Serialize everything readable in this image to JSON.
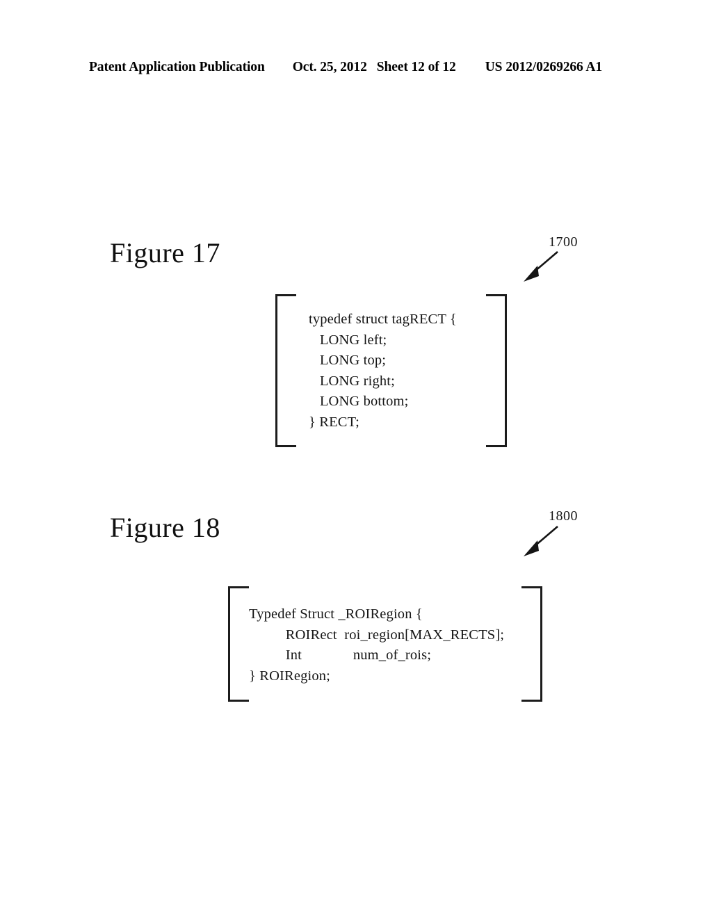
{
  "header": {
    "publication": "Patent Application Publication",
    "date": "Oct. 25, 2012",
    "sheet": "Sheet 12 of 12",
    "patent_number": "US 2012/0269266 A1"
  },
  "figures": [
    {
      "title": "Figure 17",
      "reference_numeral": "1700",
      "code_lines": [
        "typedef struct tagRECT {",
        "   LONG left;",
        "   LONG top;",
        "   LONG right;",
        "   LONG bottom;",
        "} RECT;"
      ]
    },
    {
      "title": "Figure 18",
      "reference_numeral": "1800",
      "code_lines": [
        "Typedef Struct _ROIRegion {",
        "          ROIRect  roi_region[MAX_RECTS];",
        "          Int              num_of_rois;",
        "} ROIRegion;"
      ]
    }
  ]
}
